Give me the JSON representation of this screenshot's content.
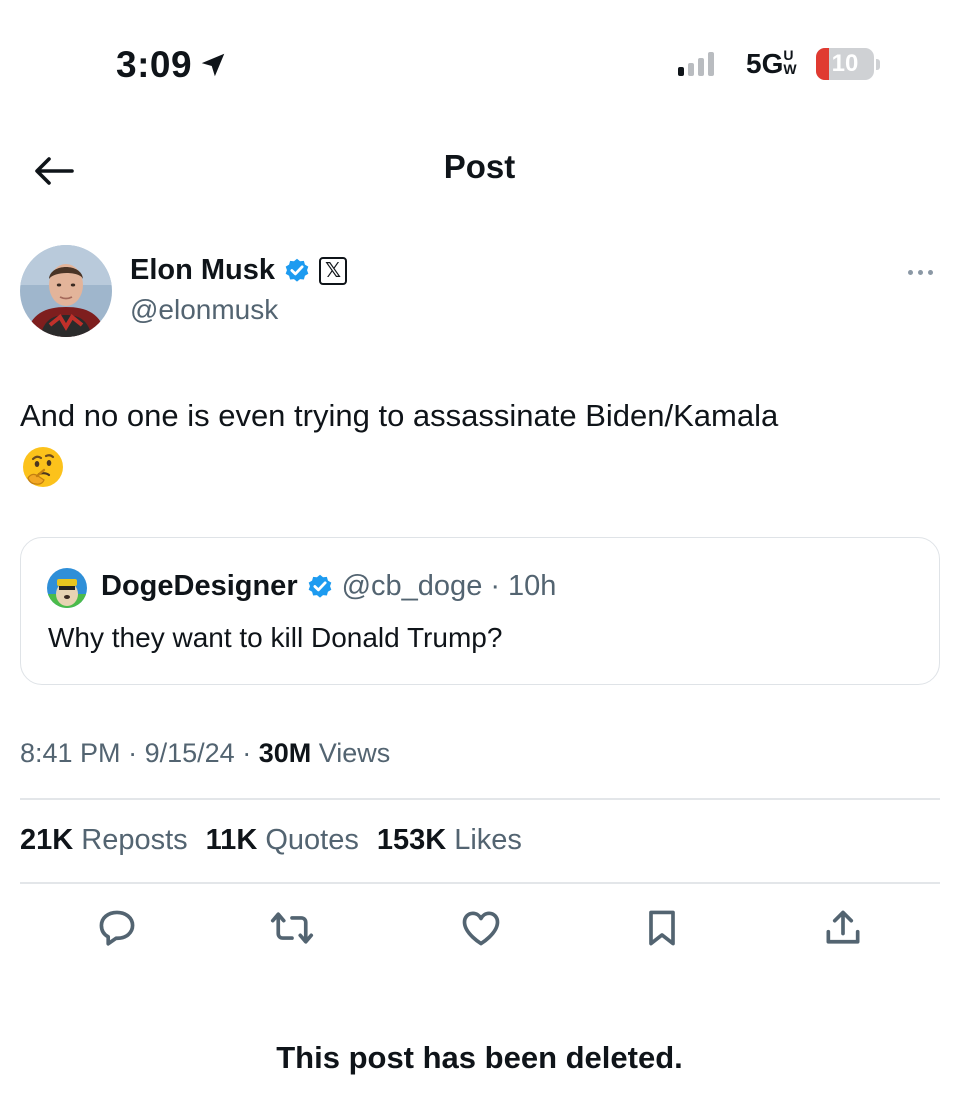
{
  "status_bar": {
    "time": "3:09",
    "network": "5G",
    "network_suffix": "UW",
    "battery": "10",
    "battery_level": 0.1,
    "signal_bars_active": 1,
    "signal_bars_total": 4
  },
  "header": {
    "title": "Post",
    "back_icon": "arrow-left-icon"
  },
  "author": {
    "name": "Elon Musk",
    "handle": "@elonmusk",
    "verified_icon": "verified-badge-icon",
    "affiliate_icon": "x-logo-icon",
    "affiliate_glyph": "𝕏"
  },
  "post": {
    "text": "And no one is even trying to assassinate Biden/Kamala",
    "emoji": "thinking-face-emoji"
  },
  "quote": {
    "name": "DogeDesigner",
    "handle": "@cb_doge",
    "time": "· 10h",
    "text": "Why they want to kill Donald Trump?"
  },
  "meta": {
    "time": "8:41 PM",
    "sep1": "·",
    "date": "9/15/24",
    "sep2": "·",
    "views_count": "30M",
    "views_label": "Views"
  },
  "stats": [
    {
      "count": "21K",
      "label": "Reposts"
    },
    {
      "count": "11K",
      "label": "Quotes"
    },
    {
      "count": "153K",
      "label": "Likes"
    }
  ],
  "actions": [
    "reply-icon",
    "repost-icon",
    "like-icon",
    "bookmark-icon",
    "share-icon"
  ],
  "deleted_notice": "This post has been deleted.",
  "colors": {
    "text": "#0f1419",
    "secondary": "#536471",
    "verified": "#1d9bf0",
    "border": "#dfe3e7",
    "battery_low": "#e03a31"
  }
}
